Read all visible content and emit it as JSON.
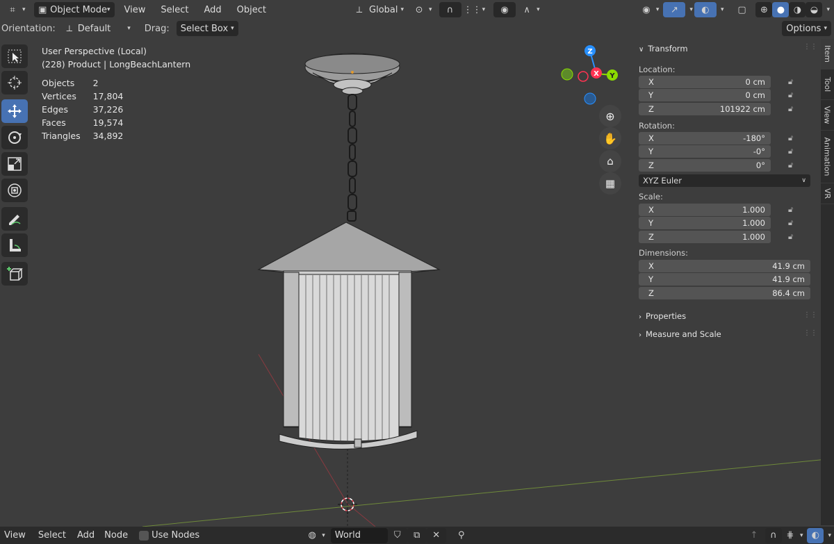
{
  "header": {
    "mode_label": "Object Mode",
    "menu": [
      "View",
      "Select",
      "Add",
      "Object"
    ],
    "transform_orientation": "Global",
    "editor_icon": "editor-type-icon"
  },
  "subheader": {
    "orientation_label": "Orientation:",
    "orientation_value": "Default",
    "drag_label": "Drag:",
    "drag_value": "Select Box",
    "options_label": "Options"
  },
  "viewport_info": {
    "perspective": "User Perspective (Local)",
    "collection": "(228) Product | LongBeachLantern",
    "stats": [
      {
        "label": "Objects",
        "value": "2"
      },
      {
        "label": "Vertices",
        "value": "17,804"
      },
      {
        "label": "Edges",
        "value": "37,226"
      },
      {
        "label": "Faces",
        "value": "19,574"
      },
      {
        "label": "Triangles",
        "value": "34,892"
      }
    ]
  },
  "gizmo": {
    "axes": [
      "Z",
      "X",
      "Y"
    ],
    "colors": {
      "x": "#ff3352",
      "y": "#8bdc00",
      "z": "#2890ff"
    }
  },
  "npanel": {
    "transform_title": "Transform",
    "location_label": "Location:",
    "location": [
      {
        "axis": "X",
        "value": "0 cm"
      },
      {
        "axis": "Y",
        "value": "0 cm"
      },
      {
        "axis": "Z",
        "value": "101922 cm"
      }
    ],
    "rotation_label": "Rotation:",
    "rotation": [
      {
        "axis": "X",
        "value": "-180°"
      },
      {
        "axis": "Y",
        "value": "-0°"
      },
      {
        "axis": "Z",
        "value": "0°"
      }
    ],
    "rotation_mode": "XYZ Euler",
    "scale_label": "Scale:",
    "scale": [
      {
        "axis": "X",
        "value": "1.000"
      },
      {
        "axis": "Y",
        "value": "1.000"
      },
      {
        "axis": "Z",
        "value": "1.000"
      }
    ],
    "dimensions_label": "Dimensions:",
    "dimensions": [
      {
        "axis": "X",
        "value": "41.9 cm"
      },
      {
        "axis": "Y",
        "value": "41.9 cm"
      },
      {
        "axis": "Z",
        "value": "86.4 cm"
      }
    ],
    "properties_label": "Properties",
    "measure_label": "Measure and Scale"
  },
  "side_tabs": [
    "Item",
    "Tool",
    "View",
    "Animation",
    "VR"
  ],
  "bottombar": {
    "menu": [
      "View",
      "Select",
      "Add",
      "Node"
    ],
    "use_nodes_label": "Use Nodes",
    "world_name": "World"
  },
  "colors": {
    "accent": "#4772b3",
    "bg": "#3d3d3d",
    "panel": "#2b2b2b"
  }
}
